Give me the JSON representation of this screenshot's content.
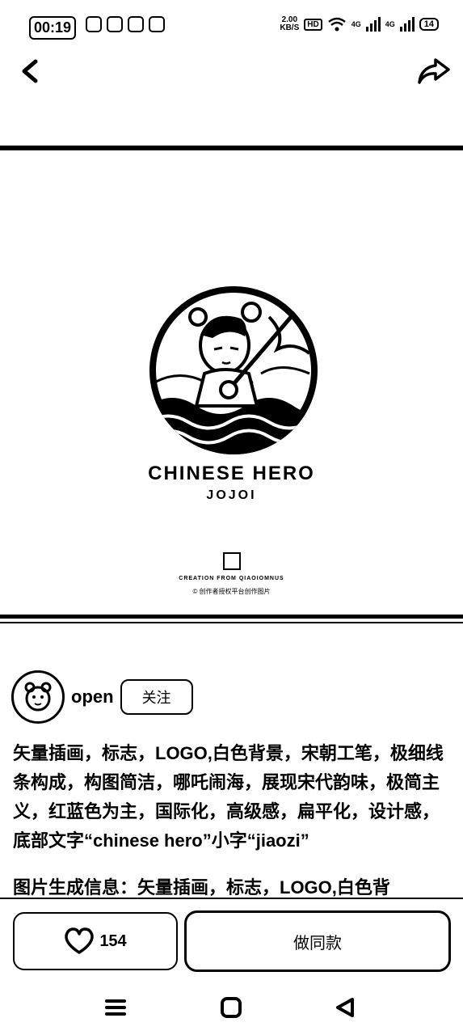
{
  "status_bar": {
    "time": "00:19",
    "speed_value": "2.00",
    "speed_unit": "KB/S",
    "hd": "HD",
    "network_1": "4G",
    "network_2": "4G",
    "battery": "14"
  },
  "nav": {
    "back_icon": "chevron-left-icon",
    "share_icon": "share-arrow-icon"
  },
  "artwork": {
    "title": "CHINESE HERO",
    "subtitle": "JOJOI",
    "credit_line1": "CREATION FROM QIAOIOMNUS",
    "credit_line2": "© 创作者授权平台创作图片"
  },
  "author": {
    "name": "open",
    "follow_label": "关注"
  },
  "prompt": "矢量插画，标志，LOGO,白色背景，宋朝工笔，极细线条构成，构图简洁，哪吒闹海，展现宋代韵味，极简主义，红蓝色为主，国际化，高级感，扁平化，设计感，底部文字“chinese hero”小字“jiaozi”",
  "gen_info": "图片生成信息：矢量插画，标志，LOGO,白色背",
  "actions": {
    "like_count": "154",
    "same_style_label": "做同款"
  },
  "system_nav": {
    "menu_icon": "menu-icon",
    "home_icon": "home-icon",
    "back_icon": "back-triangle-icon"
  }
}
